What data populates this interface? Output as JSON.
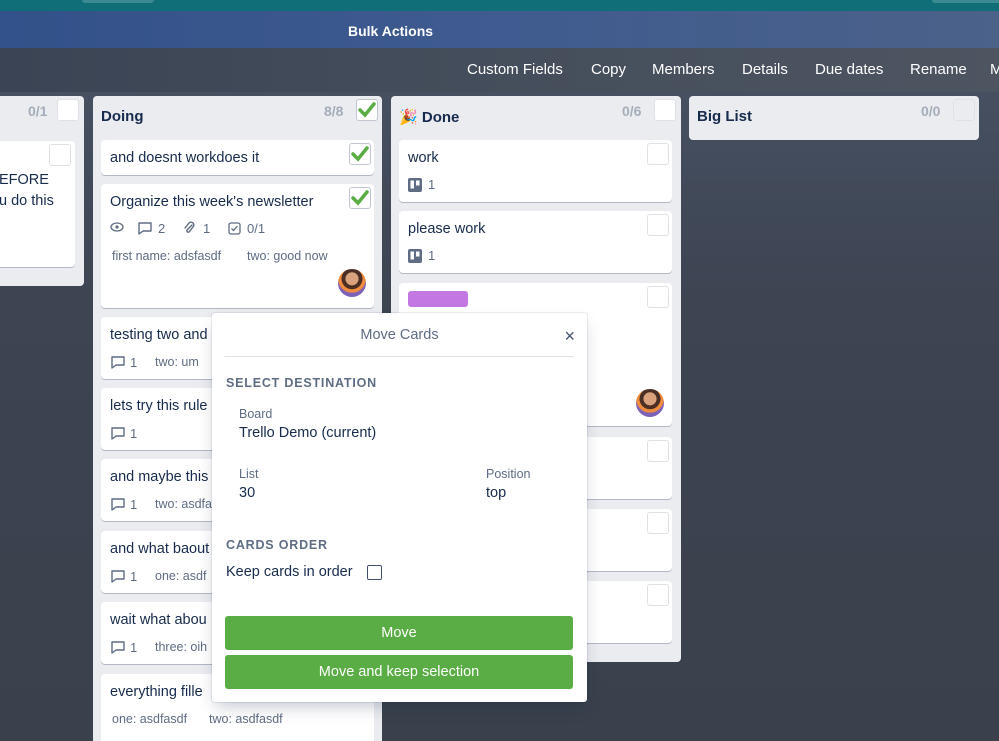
{
  "header": {
    "title": "Bulk Actions"
  },
  "actions": [
    "Custom Fields",
    "Copy",
    "Members",
    "Details",
    "Due dates",
    "Rename",
    "M"
  ],
  "lists": {
    "left": {
      "count": "0/1",
      "card_text": [
        "EFORE",
        "u do this"
      ]
    },
    "doing": {
      "name": "Doing",
      "count": "8/8",
      "cards": [
        {
          "title": "and doesnt workdoes it"
        },
        {
          "title": "Organize this week's newsletter",
          "comments": "2",
          "attachments": "1",
          "checklist": "0/1",
          "field1": "first name: adsfasdf",
          "field2": "two: good now"
        },
        {
          "title": "testing two and",
          "comments": "1",
          "field1": "two: um"
        },
        {
          "title": "lets try this rule",
          "comments": "1"
        },
        {
          "title": "and maybe this",
          "comments": "1",
          "field1": "two: asdfa"
        },
        {
          "title": "and what baout",
          "comments": "1",
          "field1": "one: asdf"
        },
        {
          "title": "wait what abou",
          "comments": "1",
          "field1": "three: oih"
        },
        {
          "title": "everything fille",
          "field1": "one: asdfasdf",
          "field2": "two: asdfasdf"
        }
      ]
    },
    "done": {
      "emoji": "🎉",
      "name": "Done",
      "count": "0/6",
      "cards": [
        {
          "title": "work",
          "badge": "1"
        },
        {
          "title": "please work",
          "badge": "1"
        }
      ]
    },
    "big": {
      "name": "Big List",
      "count": "0/0"
    }
  },
  "modal": {
    "title": "Move Cards",
    "close": "×",
    "section_destination": "SELECT DESTINATION",
    "board_label": "Board",
    "board_value": "Trello Demo (current)",
    "list_label": "List",
    "list_value": "30",
    "position_label": "Position",
    "position_value": "top",
    "section_order": "CARDS ORDER",
    "keep_order_label": "Keep cards in order",
    "move_button": "Move",
    "move_keep_button": "Move and keep selection"
  },
  "colors": {
    "accent_green": "#5aac44",
    "label_purple": "#c377e0",
    "check_green": "#5aac44"
  }
}
